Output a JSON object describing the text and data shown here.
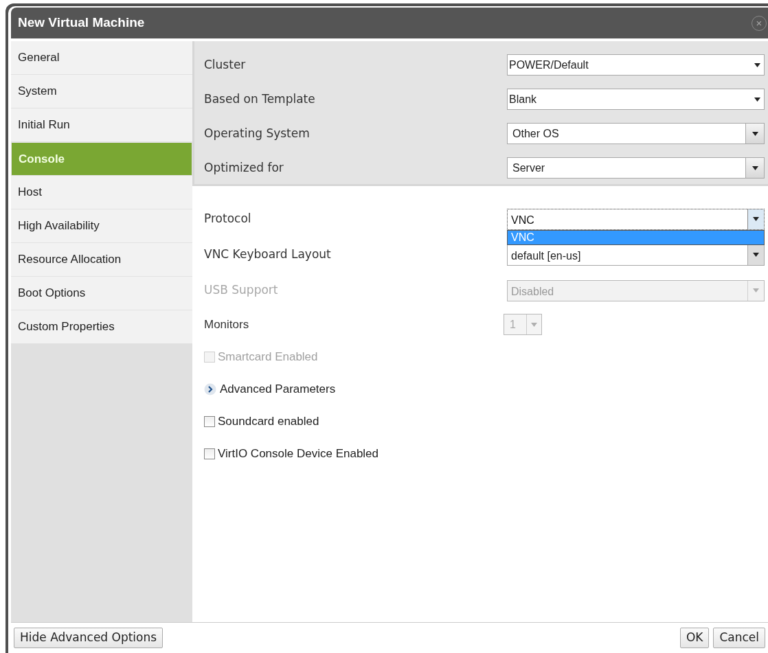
{
  "window": {
    "title": "New Virtual Machine",
    "close": "×"
  },
  "sidebar": {
    "items": [
      {
        "label": "General",
        "selected": false
      },
      {
        "label": "System",
        "selected": false
      },
      {
        "label": "Initial Run",
        "selected": false
      },
      {
        "label": "Console",
        "selected": true
      },
      {
        "label": "Host",
        "selected": false
      },
      {
        "label": "High Availability",
        "selected": false
      },
      {
        "label": "Resource Allocation",
        "selected": false
      },
      {
        "label": "Boot Options",
        "selected": false
      },
      {
        "label": "Custom Properties",
        "selected": false
      }
    ]
  },
  "general_fields": [
    {
      "label": "Cluster",
      "value": "POWER/Default",
      "kind": "plain"
    },
    {
      "label": "Based on Template",
      "value": "Blank",
      "kind": "plain"
    },
    {
      "label": "Operating System",
      "value": "Other OS",
      "kind": "button"
    },
    {
      "label": "Optimized for",
      "value": "Server",
      "kind": "button"
    }
  ],
  "console_fields": [
    {
      "kind": "select",
      "label": "Protocol",
      "value": "VNC",
      "disabled": false,
      "open": true,
      "options": [
        {
          "label": "VNC",
          "selected": true
        }
      ]
    },
    {
      "kind": "select",
      "label": "VNC Keyboard Layout",
      "value": "default [en-us]",
      "disabled": false,
      "open": false
    },
    {
      "kind": "select",
      "label": "USB Support",
      "value": "Disabled",
      "disabled": true,
      "open": false
    },
    {
      "kind": "spinner",
      "label": "Monitors",
      "value": "1",
      "disabled": true
    },
    {
      "kind": "checkbox",
      "label": "Smartcard Enabled",
      "checked": false,
      "disabled": true
    },
    {
      "kind": "expander",
      "label": "Advanced Parameters",
      "expanded": false
    },
    {
      "kind": "checkbox",
      "label": "Soundcard enabled",
      "checked": false,
      "disabled": false
    },
    {
      "kind": "checkbox",
      "label": "VirtIO Console Device Enabled",
      "checked": false,
      "disabled": false
    }
  ],
  "footer": {
    "left_button": "Hide Advanced Options",
    "buttons": [
      "OK",
      "Cancel"
    ]
  }
}
